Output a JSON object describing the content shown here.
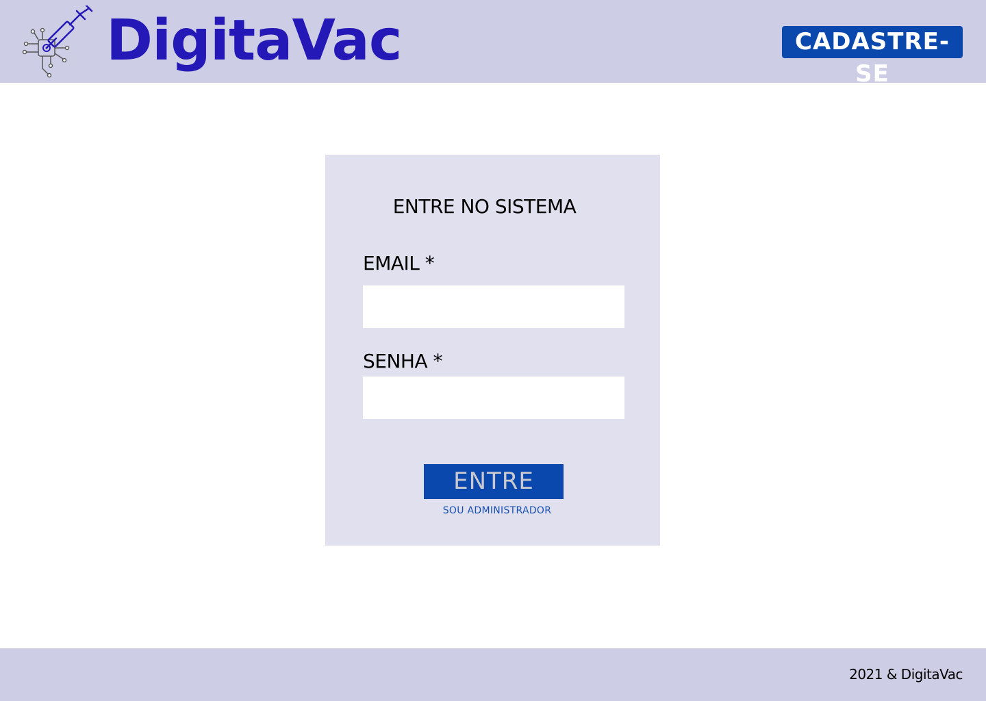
{
  "header": {
    "brand": "DigitaVac",
    "logo_icon": "syringe-circuit-icon",
    "register_label": "CADASTRE-SE"
  },
  "login": {
    "title": "ENTRE NO SISTEMA",
    "email_label": "EMAIL *",
    "email_value": "",
    "password_label": "SENHA *",
    "password_value": "",
    "submit_label": "ENTRE",
    "admin_link": "SOU ADMINISTRADOR"
  },
  "footer": {
    "text": "2021 & DigitaVac"
  },
  "colors": {
    "header_bg": "#cecde6",
    "card_bg": "#e0e0ef",
    "brand": "#2419b7",
    "button": "#0b48ad"
  }
}
